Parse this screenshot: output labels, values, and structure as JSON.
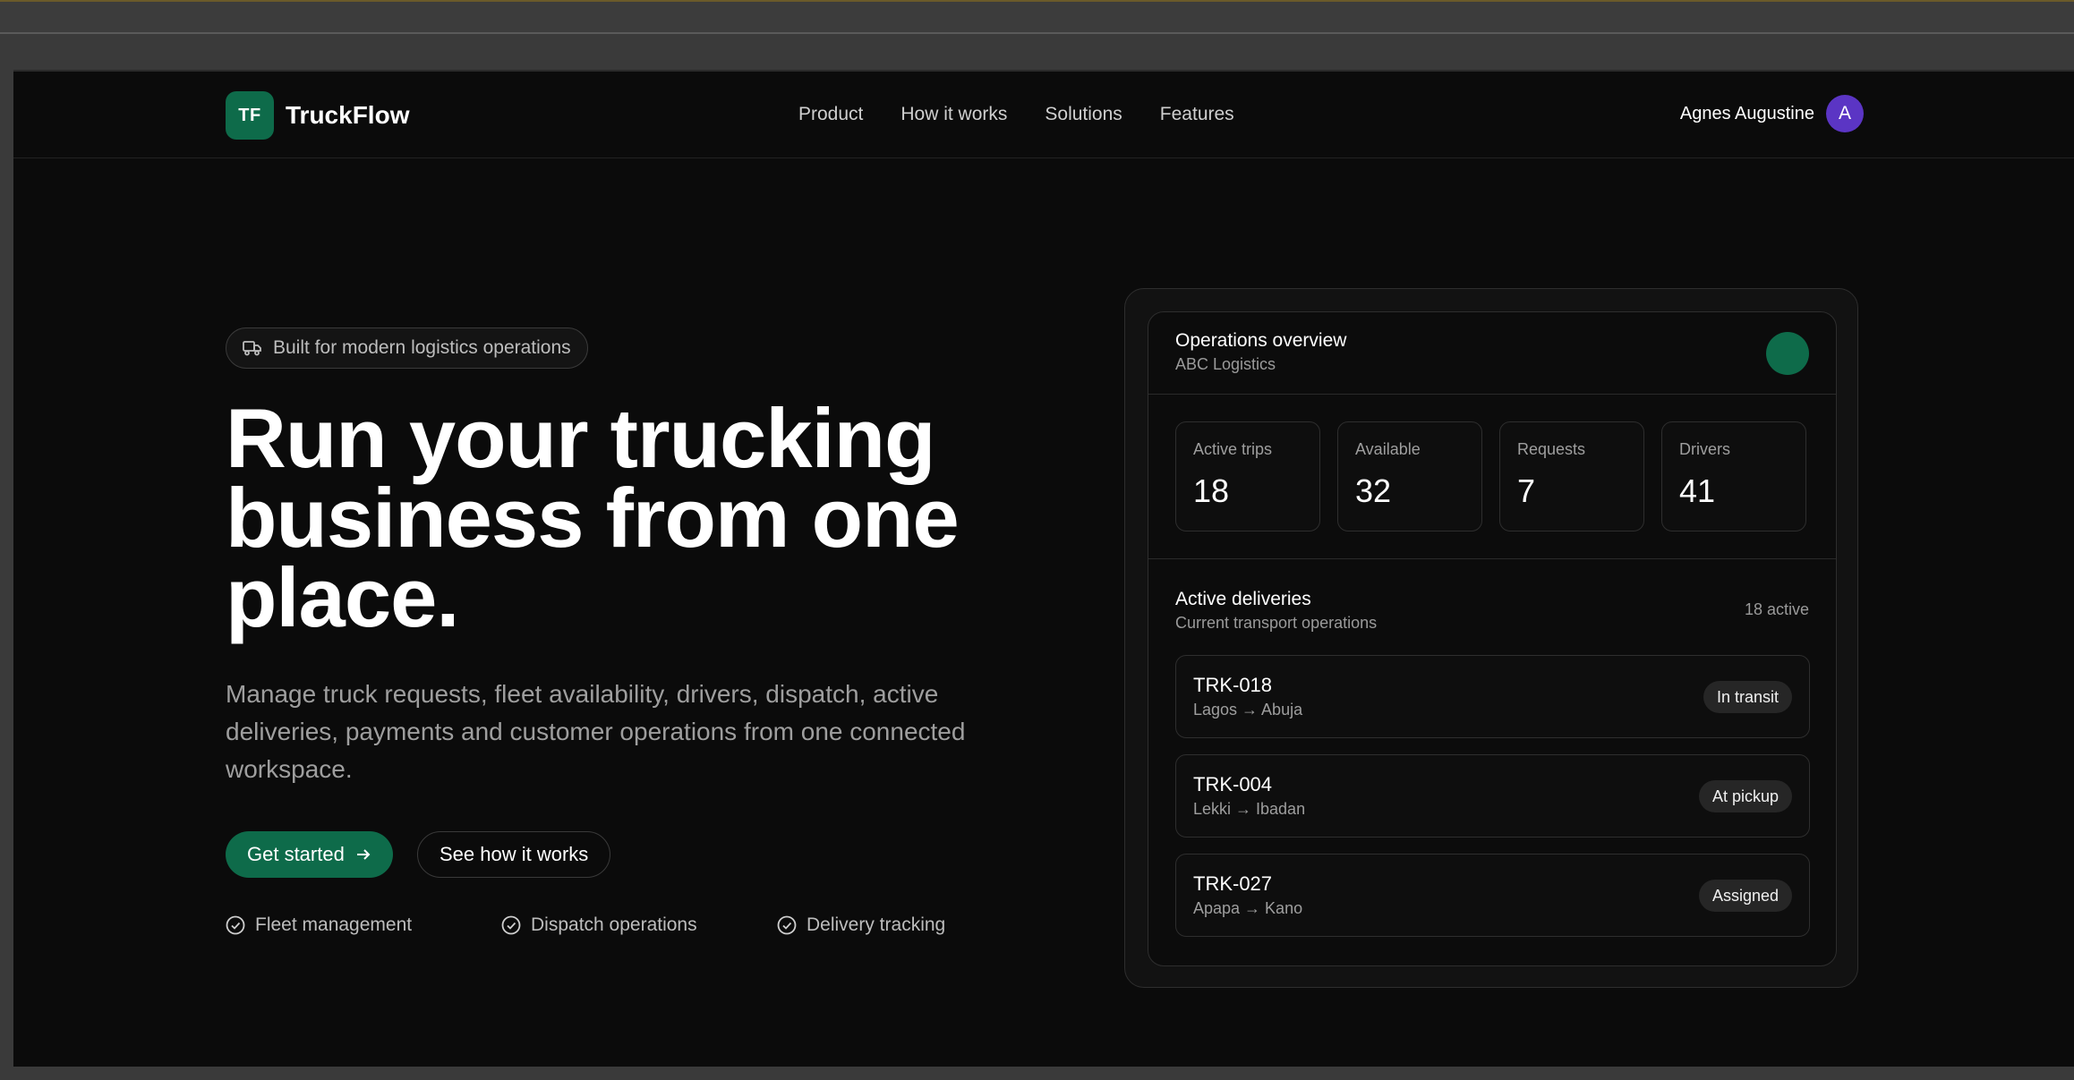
{
  "brand": {
    "badge": "TF",
    "name": "TruckFlow",
    "color": "#0e6b4a"
  },
  "nav": {
    "links": [
      "Product",
      "How it works",
      "Solutions",
      "Features"
    ],
    "user_name": "Agnes Augustine",
    "avatar_initial": "A",
    "avatar_color": "#5b35c4"
  },
  "hero": {
    "pill": "Built for modern logistics operations",
    "pill_icon": "truck-icon",
    "headline_lines": [
      "Run your trucking",
      "business from one",
      "place."
    ],
    "subtext": "Manage truck requests, fleet availability, drivers, dispatch, active deliveries, payments and customer operations from one connected workspace.",
    "primary_cta": "Get started",
    "secondary_cta": "See how it works",
    "features": [
      "Fleet management",
      "Dispatch operations",
      "Delivery tracking"
    ]
  },
  "ops": {
    "title": "Operations overview",
    "company": "ABC Logistics",
    "stats": [
      {
        "label": "Active trips",
        "value": "18"
      },
      {
        "label": "Available",
        "value": "32"
      },
      {
        "label": "Requests",
        "value": "7"
      },
      {
        "label": "Drivers",
        "value": "41"
      }
    ],
    "deliveries_title": "Active deliveries",
    "deliveries_sub": "Current transport operations",
    "deliveries_count": "18 active",
    "deliveries": [
      {
        "id": "TRK-018",
        "route": "Lagos → Abuja",
        "status": "In transit"
      },
      {
        "id": "TRK-004",
        "route": "Lekki → Ibadan",
        "status": "At pickup"
      },
      {
        "id": "TRK-027",
        "route": "Apapa → Kano",
        "status": "Assigned"
      }
    ]
  }
}
